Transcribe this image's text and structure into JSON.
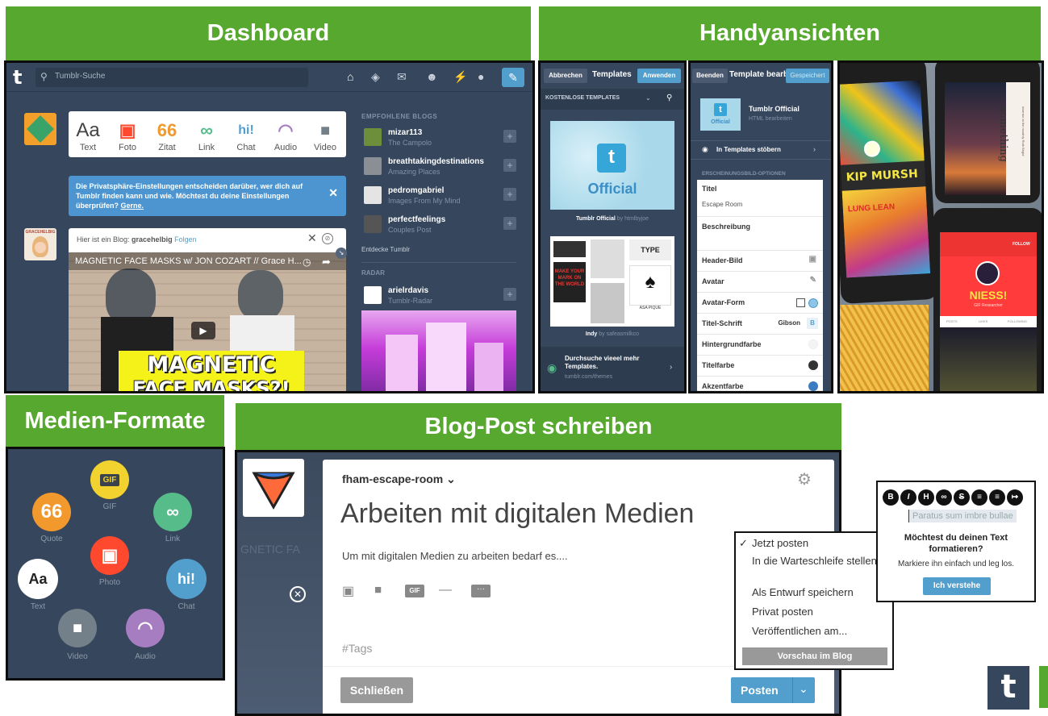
{
  "sections": {
    "dashboard": "Dashboard",
    "mobile": "Handyansichten",
    "media": "Medien-Formate",
    "compose": "Blog-Post schreiben"
  },
  "dashboard": {
    "logo": "t",
    "search_placeholder": "Tumblr-Suche",
    "post_types": [
      {
        "label": "Text",
        "glyph": "Aa",
        "color": "#444444"
      },
      {
        "label": "Foto",
        "glyph": "▣",
        "color": "#ff492f"
      },
      {
        "label": "Zitat",
        "glyph": "66",
        "color": "#f2992e"
      },
      {
        "label": "Link",
        "glyph": "∞",
        "color": "#56bc8a"
      },
      {
        "label": "Chat",
        "glyph": "hi!",
        "color": "#529ecc"
      },
      {
        "label": "Audio",
        "glyph": "◠",
        "color": "#a77dc2"
      },
      {
        "label": "Video",
        "glyph": "■",
        "color": "#748089"
      }
    ],
    "privacy_notice": "Die Privatsphäre-Einstellungen entscheiden darüber, wer dich auf Tumblr finden kann und wie. Möchtest du deine Einstellungen überprüfen?",
    "privacy_link": "Gerne.",
    "blog_avatar_label": "GRACEHELBIG",
    "post_header": "Hier ist ein Blog:",
    "post_blog": "gracehelbig",
    "post_follow": "Folgen",
    "video_title": "MAGNETIC FACE MASKS w/ JON COZART // Grace H...",
    "video_banner_1": "MAGNETIC",
    "video_banner_2": "FACE MASKS?!",
    "recommended_header": "EMPFOHLENE BLOGS",
    "blogs": [
      {
        "name": "mizar113",
        "sub": "The Campolo",
        "color": "#6b8f3a"
      },
      {
        "name": "breathtakingdestinations",
        "sub": "Amazing Places",
        "color": "#8a8f95"
      },
      {
        "name": "pedromgabriel",
        "sub": "Images From My Mind",
        "color": "#e4e4e4"
      },
      {
        "name": "perfectfeelings",
        "sub": "Couples Post",
        "color": "#555555"
      }
    ],
    "explore": "Entdecke Tumblr",
    "radar_header": "RADAR",
    "radar_blog": {
      "name": "arielrdavis",
      "sub": "Tumblr-Radar"
    }
  },
  "templates": {
    "cancel": "Abbrechen",
    "title": "Templates",
    "apply": "Anwenden",
    "filter": "KOSTENLOSE TEMPLATES",
    "card1_logo": "t",
    "card1_text": "Official",
    "card1_name": "Tumblr Official",
    "card1_by": "by htmlbyjoe",
    "card2_tiles": [
      "MAKE YOUR MARK ON THE WORLD",
      "TYPE",
      "ASA PIQUE"
    ],
    "card2_name": "Indy",
    "card2_by": "by safeasmilkco",
    "footer_title": "Durchsuche vieeel mehr Templates.",
    "footer_url": "tumblr.com/themes"
  },
  "editor": {
    "done": "Beenden",
    "title": "Template bearbeiten",
    "saved": "Gespeichert",
    "theme_name": "Tumblr Official",
    "theme_thumb": "Official",
    "theme_edit": "HTML bearbeiten",
    "browse": "In Templates stöbern",
    "options_header": "ERSCHEINUNGSBILD-OPTIONEN",
    "field_title": "Titel",
    "field_title_value": "Escape Room",
    "field_desc": "Beschreibung",
    "rows": [
      "Header-Bild",
      "Avatar",
      "Avatar-Form",
      "Titel-Schrift",
      "Hintergrundfarbe",
      "Titelfarbe",
      "Akzentfarbe"
    ],
    "font_value": "Gibson"
  },
  "phones": {
    "left_title": "KIP MURSH",
    "left_small": "LUNG LEAN",
    "right_word": "something",
    "right_sub": "inventor at the moathly Ruth Brigid",
    "profile_name": "NIESS!",
    "profile_sub": "GIF Researcher",
    "profile_follow": "FOLLOW",
    "profile_tabs": [
      "POSTS",
      "LIKES",
      "FOLLOWING"
    ]
  },
  "media": {
    "items": [
      {
        "label": "GIF",
        "glyph": "GIF",
        "color": "#f2d22e"
      },
      {
        "label": "Quote",
        "glyph": "66",
        "color": "#f2992e"
      },
      {
        "label": "Link",
        "glyph": "∞",
        "color": "#56bc8a"
      },
      {
        "label": "Photo",
        "glyph": "▣",
        "color": "#ff492f"
      },
      {
        "label": "Text",
        "glyph": "Aa",
        "color": "#ffffff"
      },
      {
        "label": "Chat",
        "glyph": "hi!",
        "color": "#529ecc"
      },
      {
        "label": "Video",
        "glyph": "■",
        "color": "#748089"
      },
      {
        "label": "Audio",
        "glyph": "◠",
        "color": "#a77dc2"
      }
    ]
  },
  "compose": {
    "blog_name": "fham-escape-room",
    "headline": "Arbeiten mit digitalen Medien",
    "body": "Um mit digitalen Medien zu arbeiten bedarf es....",
    "bg_text": "GNETIC FA",
    "tags_placeholder": "#Tags",
    "close": "Schließen",
    "post": "Posten",
    "gif": "GIF",
    "menu": [
      "Jetzt posten",
      "In die Warteschleife stellen",
      "Als Entwurf speichern",
      "Privat posten",
      "Veröffentlichen am..."
    ],
    "preview": "Vorschau im Blog",
    "format_buttons": [
      "B",
      "I",
      "H",
      "∞",
      "S",
      "≡",
      "≡",
      "↦"
    ],
    "format_placeholder": "Paratus sum imbre bullae",
    "format_question": "Möchtest du deinen Text formatieren?",
    "format_hint": "Markiere ihn einfach und leg los.",
    "format_ok": "Ich verstehe"
  },
  "brand_logo": "t",
  "colors": {
    "green": "#57a82f",
    "navy": "#36465d",
    "blue": "#529ecc",
    "notice": "#4c95d0"
  }
}
